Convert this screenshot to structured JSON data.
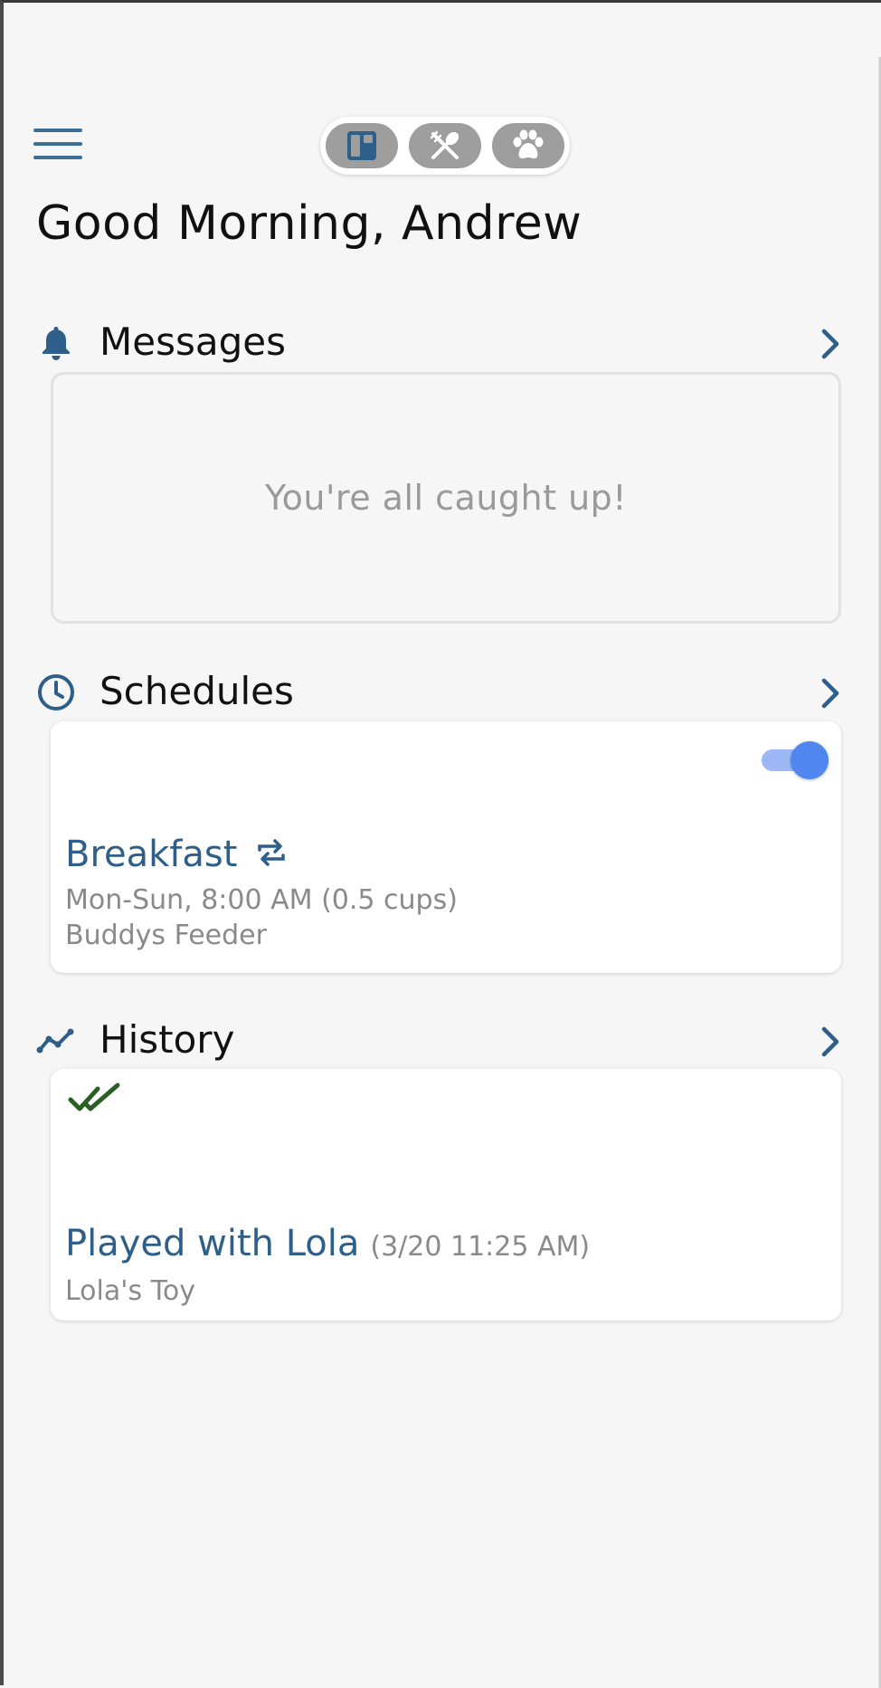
{
  "colors": {
    "accent": "#2d5f8a",
    "icon": "#3d6f96",
    "toggle_on": "#4f86ef",
    "check_green": "#2b5d24",
    "muted_text": "#8a8a8a"
  },
  "header": {
    "menu_icon": "hamburger-menu-icon",
    "switcher": {
      "active_index": 0,
      "segments": [
        {
          "icon": "dashboard-icon"
        },
        {
          "icon": "utensils-icon"
        },
        {
          "icon": "paw-icon"
        }
      ]
    }
  },
  "greeting": "Good Morning, Andrew",
  "messages": {
    "title": "Messages",
    "icon": "bell-icon",
    "empty_text": "You're all caught up!"
  },
  "schedules": {
    "title": "Schedules",
    "icon": "clock-icon",
    "item": {
      "name": "Breakfast",
      "repeat_icon": "repeat-icon",
      "enabled": true,
      "details": "Mon-Sun, 8:00 AM (0.5 cups)",
      "device": "Buddys Feeder"
    }
  },
  "history": {
    "title": "History",
    "icon": "trend-line-icon",
    "item": {
      "status_icon": "double-check-icon",
      "title": "Played with Lola",
      "time": "(3/20 11:25 AM)",
      "device": "Lola's Toy"
    }
  }
}
